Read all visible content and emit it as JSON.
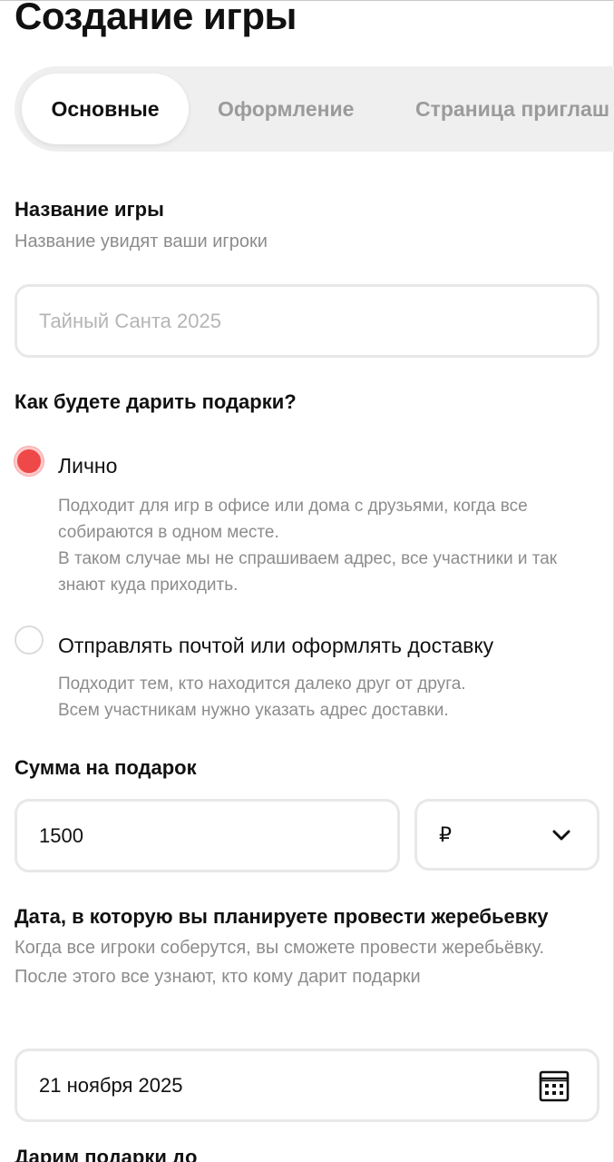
{
  "header": {
    "title": "Создание игры"
  },
  "tabs": [
    {
      "label": "Основные",
      "active": true
    },
    {
      "label": "Оформление",
      "active": false
    },
    {
      "label": "Страница приглаш",
      "active": false
    }
  ],
  "game_name": {
    "label": "Название игры",
    "hint": "Название увидят ваши игроки",
    "placeholder": "Тайный Санта 2025",
    "value": ""
  },
  "gift_mode": {
    "label": "Как будете дарить подарки?",
    "options": [
      {
        "label": "Лично",
        "selected": true,
        "description": [
          "Подходит для игр в офисе или дома с друзьями, когда все собираются в одном месте.",
          "В таком случае мы не спрашиваем адрес, все участники и так знают куда приходить."
        ]
      },
      {
        "label": "Отправлять почтой или оформлять доставку",
        "selected": false,
        "description": [
          "Подходит тем, кто находится далеко друг от друга.",
          "Всем участникам нужно указать адрес доставки."
        ]
      }
    ]
  },
  "gift_amount": {
    "label": "Сумма на подарок",
    "value": "1500",
    "currency": "₽"
  },
  "draw_date": {
    "label": "Дата, в которую вы планируете провести жеребьевку",
    "hint": "Когда все игроки соберутся, вы сможете провести жеребьёвку. После этого все узнают, кто кому дарит подарки",
    "value": "21 ноября 2025"
  },
  "next_section": {
    "label": "Дарим подарки до"
  },
  "colors": {
    "accent": "#ef4848",
    "hint_text": "#8c8c8c",
    "border": "#e8e8e8",
    "tab_bg": "#efefef"
  },
  "icons": {
    "currency_select": "chevron-down-icon",
    "date_picker": "calendar-icon"
  }
}
